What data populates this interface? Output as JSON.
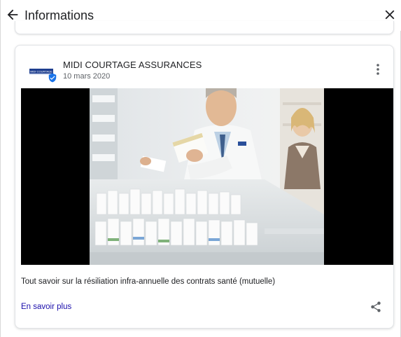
{
  "header": {
    "title": "Informations"
  },
  "post": {
    "company": "MIDI COURTAGE ASSURANCES",
    "logo_text": "MIDI COURTAGE",
    "date": "10 mars 2020",
    "text": "Tout savoir sur la résiliation infra-annuelle des contrats santé (mutuelle)",
    "link_label": "En savoir plus"
  },
  "icons": {
    "back": "arrow-back-icon",
    "close": "close-icon",
    "more": "more-vert-icon",
    "share": "share-icon",
    "verified": "verified-badge-icon"
  },
  "colors": {
    "link": "#1a0dab",
    "verified": "#1a73e8",
    "text": "#202124",
    "secondary_text": "#5f6368"
  }
}
